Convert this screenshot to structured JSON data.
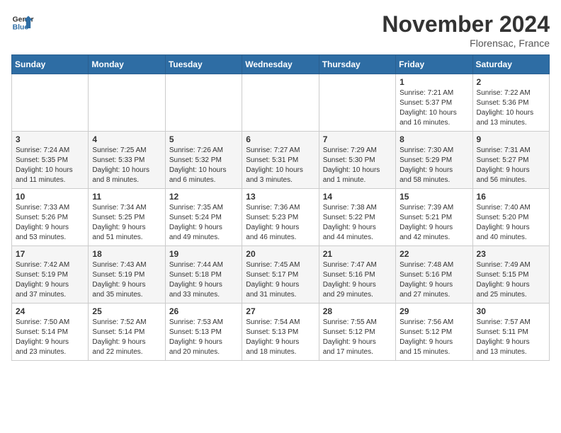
{
  "logo": {
    "line1": "General",
    "line2": "Blue"
  },
  "title": "November 2024",
  "location": "Florensac, France",
  "weekdays": [
    "Sunday",
    "Monday",
    "Tuesday",
    "Wednesday",
    "Thursday",
    "Friday",
    "Saturday"
  ],
  "weeks": [
    [
      {
        "day": "",
        "info": ""
      },
      {
        "day": "",
        "info": ""
      },
      {
        "day": "",
        "info": ""
      },
      {
        "day": "",
        "info": ""
      },
      {
        "day": "",
        "info": ""
      },
      {
        "day": "1",
        "info": "Sunrise: 7:21 AM\nSunset: 5:37 PM\nDaylight: 10 hours\nand 16 minutes."
      },
      {
        "day": "2",
        "info": "Sunrise: 7:22 AM\nSunset: 5:36 PM\nDaylight: 10 hours\nand 13 minutes."
      }
    ],
    [
      {
        "day": "3",
        "info": "Sunrise: 7:24 AM\nSunset: 5:35 PM\nDaylight: 10 hours\nand 11 minutes."
      },
      {
        "day": "4",
        "info": "Sunrise: 7:25 AM\nSunset: 5:33 PM\nDaylight: 10 hours\nand 8 minutes."
      },
      {
        "day": "5",
        "info": "Sunrise: 7:26 AM\nSunset: 5:32 PM\nDaylight: 10 hours\nand 6 minutes."
      },
      {
        "day": "6",
        "info": "Sunrise: 7:27 AM\nSunset: 5:31 PM\nDaylight: 10 hours\nand 3 minutes."
      },
      {
        "day": "7",
        "info": "Sunrise: 7:29 AM\nSunset: 5:30 PM\nDaylight: 10 hours\nand 1 minute."
      },
      {
        "day": "8",
        "info": "Sunrise: 7:30 AM\nSunset: 5:29 PM\nDaylight: 9 hours\nand 58 minutes."
      },
      {
        "day": "9",
        "info": "Sunrise: 7:31 AM\nSunset: 5:27 PM\nDaylight: 9 hours\nand 56 minutes."
      }
    ],
    [
      {
        "day": "10",
        "info": "Sunrise: 7:33 AM\nSunset: 5:26 PM\nDaylight: 9 hours\nand 53 minutes."
      },
      {
        "day": "11",
        "info": "Sunrise: 7:34 AM\nSunset: 5:25 PM\nDaylight: 9 hours\nand 51 minutes."
      },
      {
        "day": "12",
        "info": "Sunrise: 7:35 AM\nSunset: 5:24 PM\nDaylight: 9 hours\nand 49 minutes."
      },
      {
        "day": "13",
        "info": "Sunrise: 7:36 AM\nSunset: 5:23 PM\nDaylight: 9 hours\nand 46 minutes."
      },
      {
        "day": "14",
        "info": "Sunrise: 7:38 AM\nSunset: 5:22 PM\nDaylight: 9 hours\nand 44 minutes."
      },
      {
        "day": "15",
        "info": "Sunrise: 7:39 AM\nSunset: 5:21 PM\nDaylight: 9 hours\nand 42 minutes."
      },
      {
        "day": "16",
        "info": "Sunrise: 7:40 AM\nSunset: 5:20 PM\nDaylight: 9 hours\nand 40 minutes."
      }
    ],
    [
      {
        "day": "17",
        "info": "Sunrise: 7:42 AM\nSunset: 5:19 PM\nDaylight: 9 hours\nand 37 minutes."
      },
      {
        "day": "18",
        "info": "Sunrise: 7:43 AM\nSunset: 5:19 PM\nDaylight: 9 hours\nand 35 minutes."
      },
      {
        "day": "19",
        "info": "Sunrise: 7:44 AM\nSunset: 5:18 PM\nDaylight: 9 hours\nand 33 minutes."
      },
      {
        "day": "20",
        "info": "Sunrise: 7:45 AM\nSunset: 5:17 PM\nDaylight: 9 hours\nand 31 minutes."
      },
      {
        "day": "21",
        "info": "Sunrise: 7:47 AM\nSunset: 5:16 PM\nDaylight: 9 hours\nand 29 minutes."
      },
      {
        "day": "22",
        "info": "Sunrise: 7:48 AM\nSunset: 5:16 PM\nDaylight: 9 hours\nand 27 minutes."
      },
      {
        "day": "23",
        "info": "Sunrise: 7:49 AM\nSunset: 5:15 PM\nDaylight: 9 hours\nand 25 minutes."
      }
    ],
    [
      {
        "day": "24",
        "info": "Sunrise: 7:50 AM\nSunset: 5:14 PM\nDaylight: 9 hours\nand 23 minutes."
      },
      {
        "day": "25",
        "info": "Sunrise: 7:52 AM\nSunset: 5:14 PM\nDaylight: 9 hours\nand 22 minutes."
      },
      {
        "day": "26",
        "info": "Sunrise: 7:53 AM\nSunset: 5:13 PM\nDaylight: 9 hours\nand 20 minutes."
      },
      {
        "day": "27",
        "info": "Sunrise: 7:54 AM\nSunset: 5:13 PM\nDaylight: 9 hours\nand 18 minutes."
      },
      {
        "day": "28",
        "info": "Sunrise: 7:55 AM\nSunset: 5:12 PM\nDaylight: 9 hours\nand 17 minutes."
      },
      {
        "day": "29",
        "info": "Sunrise: 7:56 AM\nSunset: 5:12 PM\nDaylight: 9 hours\nand 15 minutes."
      },
      {
        "day": "30",
        "info": "Sunrise: 7:57 AM\nSunset: 5:11 PM\nDaylight: 9 hours\nand 13 minutes."
      }
    ]
  ]
}
